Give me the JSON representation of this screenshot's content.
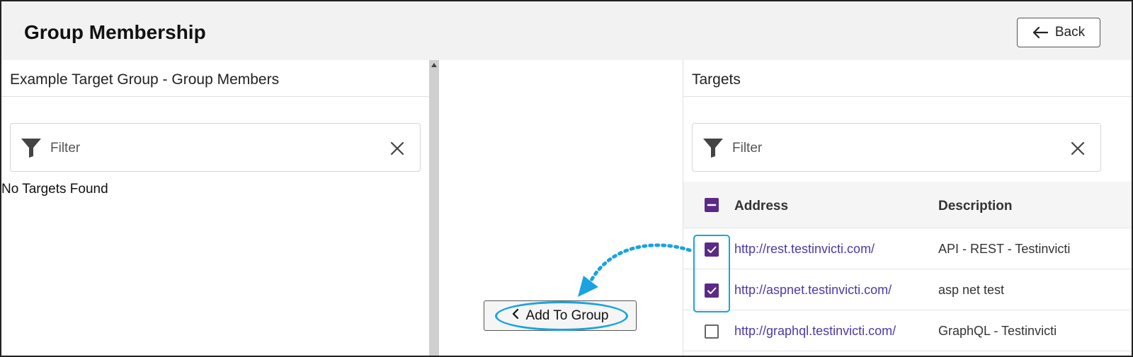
{
  "header": {
    "title": "Group Membership",
    "back_label": "Back"
  },
  "left_panel": {
    "title": "Example Target Group - Group Members",
    "filter_placeholder": "Filter",
    "empty_text": "No Targets Found"
  },
  "middle": {
    "add_label": "Add To Group"
  },
  "right_panel": {
    "title": "Targets",
    "filter_placeholder": "Filter",
    "columns": [
      "Address",
      "Description"
    ],
    "header_checkbox_state": "indeterminate",
    "rows": [
      {
        "address": "http://rest.testinvicti.com/",
        "description": "API - REST - Testinvicti",
        "checked": true
      },
      {
        "address": "http://aspnet.testinvicti.com/",
        "description": "asp net test",
        "checked": true
      },
      {
        "address": "http://graphql.testinvicti.com/",
        "description": "GraphQL - Testinvicti",
        "checked": false
      }
    ]
  },
  "colors": {
    "accent": "#5b2a86",
    "link": "#4a3aa8",
    "annotation": "#1aa3e0",
    "header_bg": "#f2f2f2"
  },
  "icons": [
    "arrow-left-icon",
    "filter-icon",
    "close-icon",
    "chevron-left-icon",
    "check-icon",
    "minus-icon"
  ]
}
